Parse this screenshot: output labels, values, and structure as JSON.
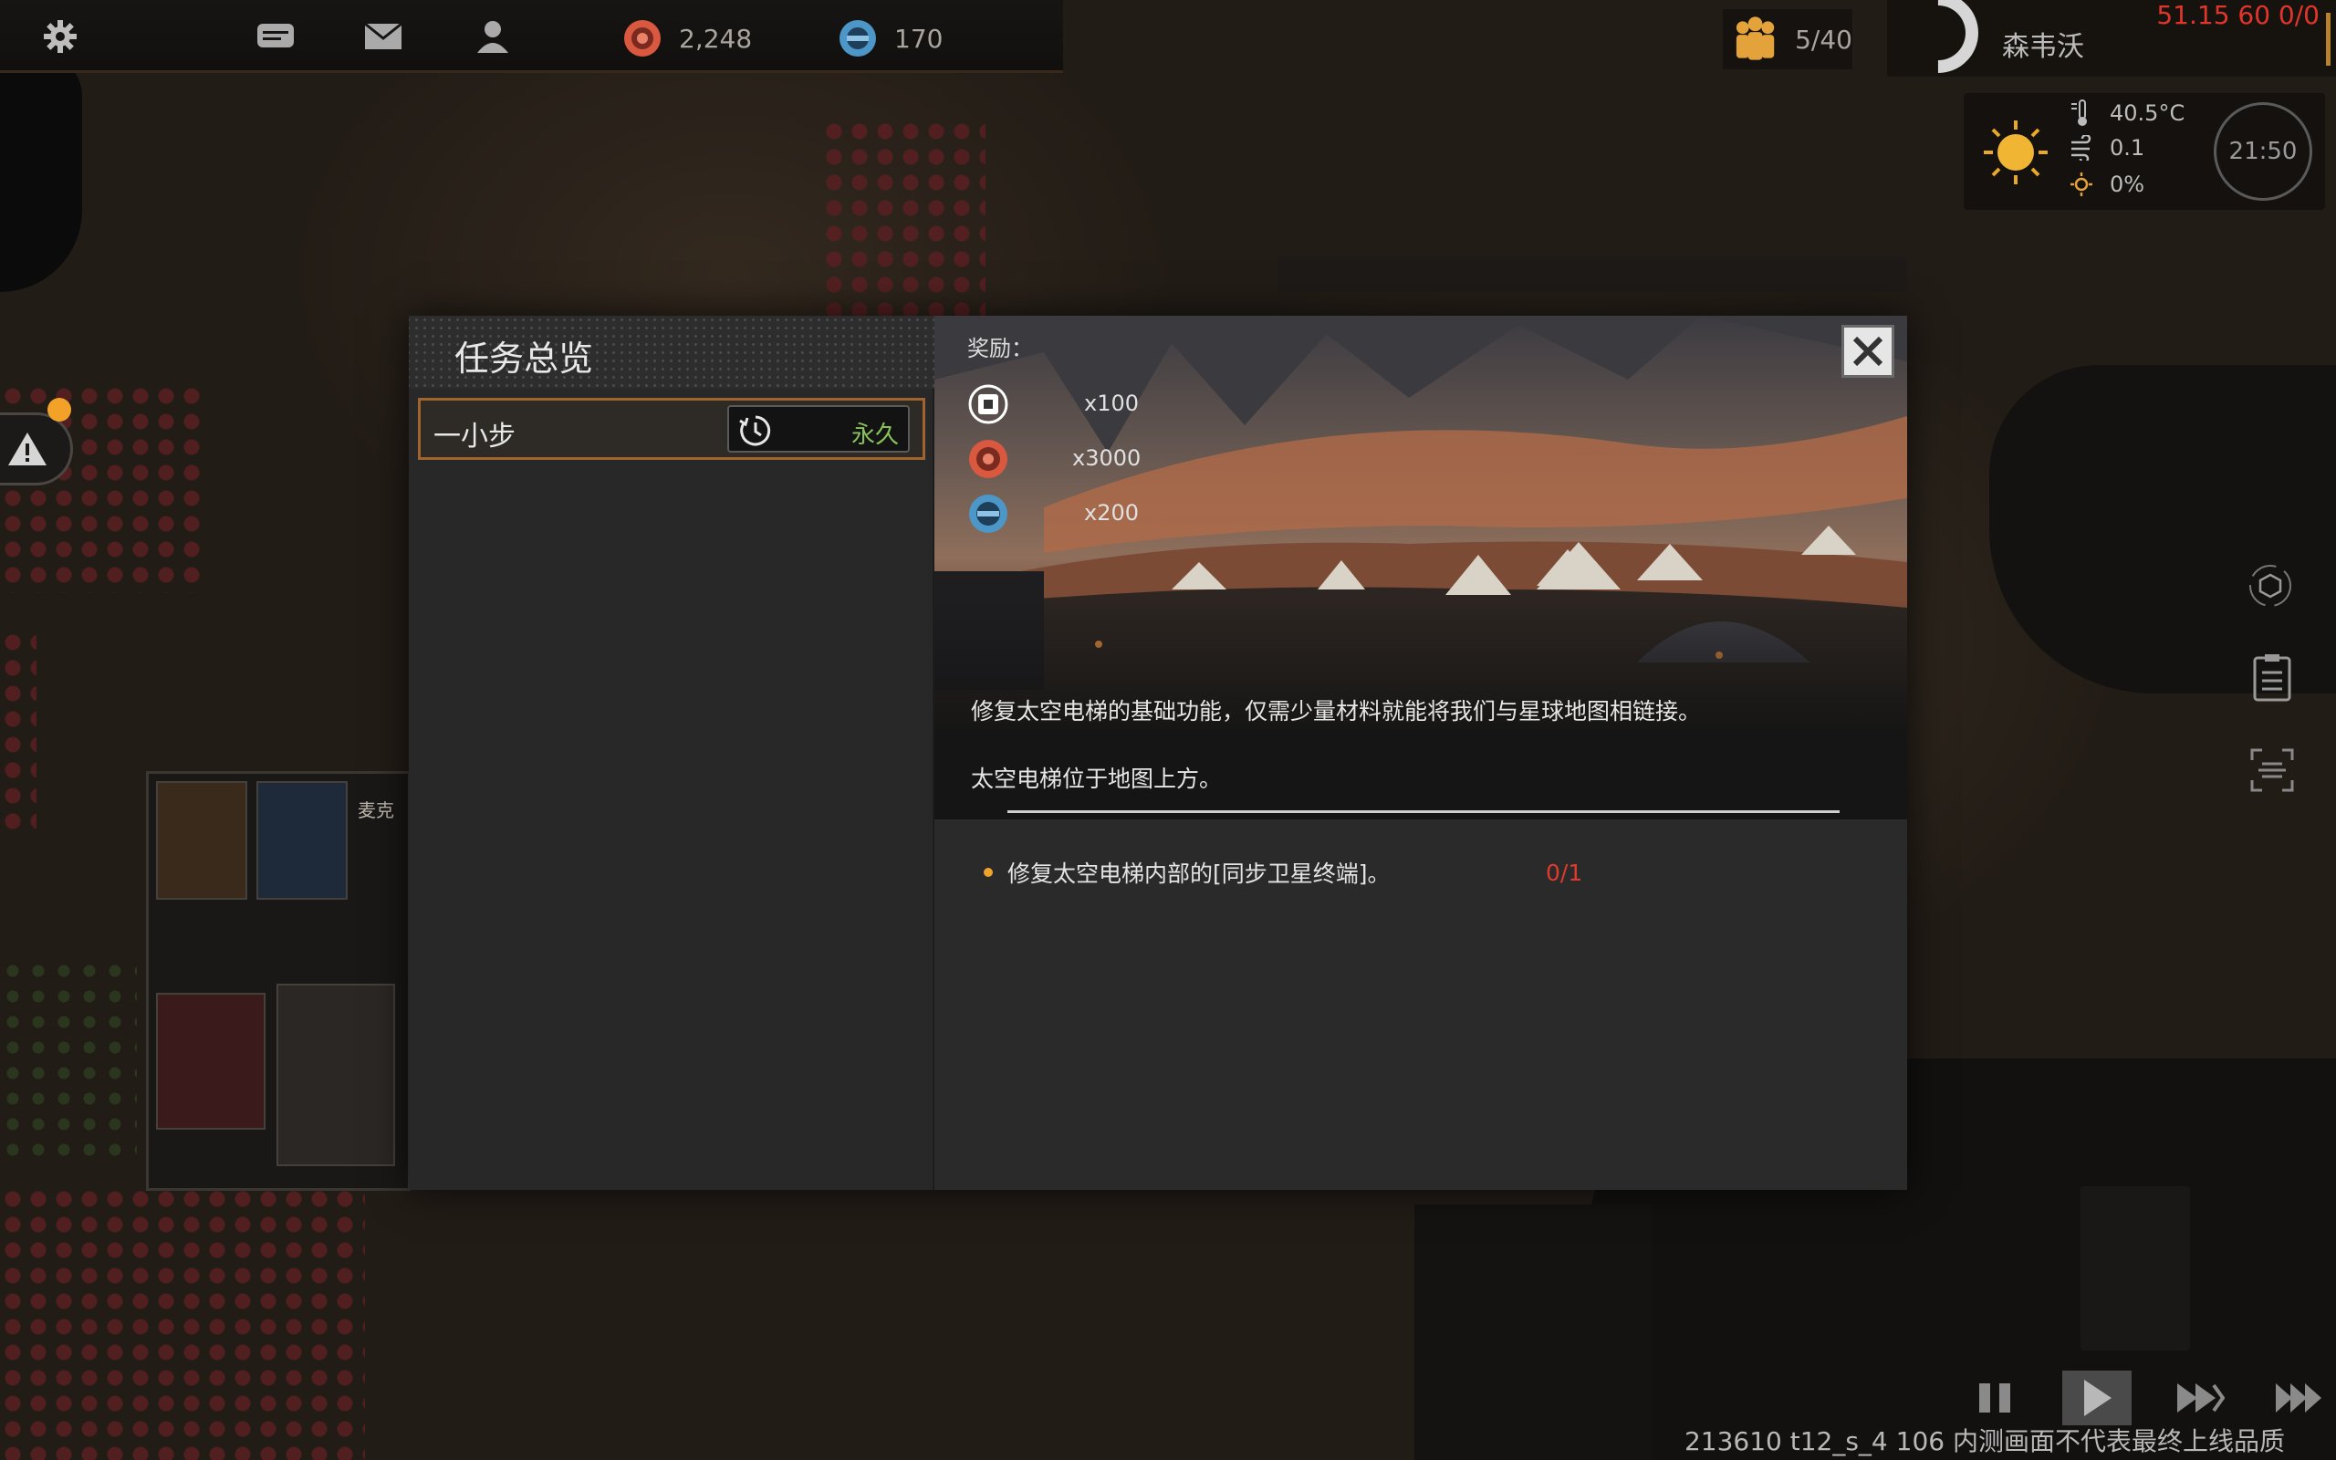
{
  "topbar": {
    "icons": [
      "gear-icon",
      "chat-icon",
      "mail-icon",
      "people-icon"
    ],
    "resources": [
      {
        "name": "red-coin-icon",
        "value": "2,248",
        "color": "#d8593f"
      },
      {
        "name": "blue-coin-icon",
        "value": "170",
        "color": "#4d97c8"
      }
    ],
    "population": "5/40",
    "player_name": "森韦沃",
    "debug": "51.15 60 0/0"
  },
  "weather": {
    "temperature": "40.5°C",
    "wind": "0.1",
    "light": "0%",
    "time": "21:50"
  },
  "map": {
    "label": "麦克",
    "build_info": "213610 t12_s_4 106  内测画面不代表最终上线品质"
  },
  "quest_panel": {
    "title": "任务总览",
    "items": [
      {
        "name": "一小步",
        "duration": "永久"
      }
    ]
  },
  "quest_detail": {
    "reward_title": "奖励：",
    "rewards": [
      {
        "icon": "chip-icon",
        "qty": "x100",
        "color": "#ffffff"
      },
      {
        "icon": "red-coin-icon",
        "qty": "x3000",
        "color": "#d8593f"
      },
      {
        "icon": "blue-coin-icon",
        "qty": "x200",
        "color": "#4d97c8"
      }
    ],
    "description_1": "修复太空电梯的基础功能，仅需少量材料就能将我们与星球地图相链接。",
    "description_2": "太空电梯位于地图上方。",
    "objectives": [
      {
        "text": "修复太空电梯内部的[同步卫星终端]。",
        "progress": "0/1"
      }
    ]
  },
  "colors": {
    "accent": "#a0652e",
    "progress_red": "#e03a2e",
    "duration_green": "#88c35a"
  }
}
